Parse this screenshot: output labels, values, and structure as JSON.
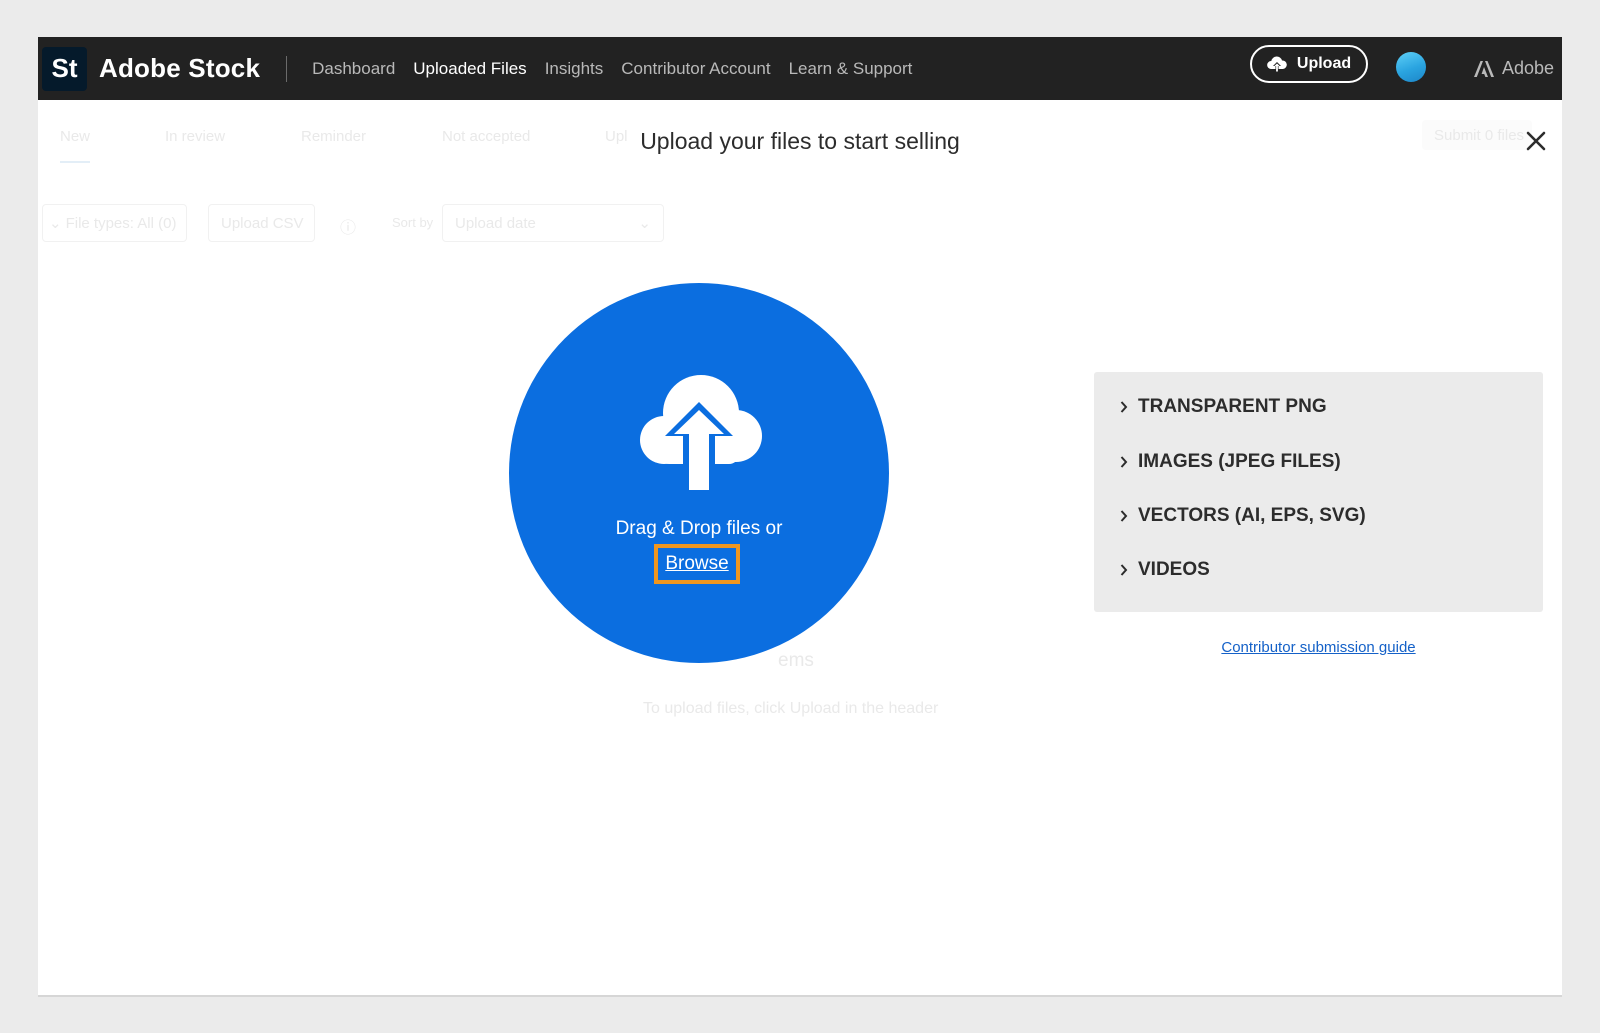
{
  "header": {
    "logo_text": "St",
    "brand": "Adobe Stock",
    "nav": [
      {
        "label": "Dashboard",
        "active": false
      },
      {
        "label": "Uploaded Files",
        "active": true
      },
      {
        "label": "Insights",
        "active": false
      },
      {
        "label": "Contributor Account",
        "active": false
      },
      {
        "label": "Learn & Support",
        "active": false
      }
    ],
    "upload_label": "Upload",
    "adobe_label": "Adobe"
  },
  "background": {
    "tabs": [
      "New",
      "In review",
      "Reminder",
      "Not accepted",
      "Upl"
    ],
    "submit_label": "Submit 0 files",
    "file_types_label": "File types: All (0)",
    "upload_csv_label": "Upload CSV",
    "sort_by_label": "Sort by",
    "sort_value": "Upload date",
    "empty_title": "ems",
    "empty_hint": "To upload files, click Upload in the header"
  },
  "modal": {
    "title": "Upload your files to start selling",
    "drop_text": "Drag & Drop files or",
    "browse_label": "Browse",
    "file_types": [
      "TRANSPARENT PNG",
      "IMAGES (JPEG FILES)",
      "VECTORS (AI, EPS, SVG)",
      "VIDEOS"
    ],
    "guide_link": "Contributor submission guide"
  },
  "colors": {
    "header_bg": "#222222",
    "drop_circle": "#0b6ee0",
    "highlight": "#f0961f",
    "link": "#1461c8"
  },
  "icons": {
    "upload": "cloud-upload-icon",
    "close": "close-icon",
    "type_chevron": "chevron-right-icon",
    "adobe": "adobe-logo-icon"
  }
}
